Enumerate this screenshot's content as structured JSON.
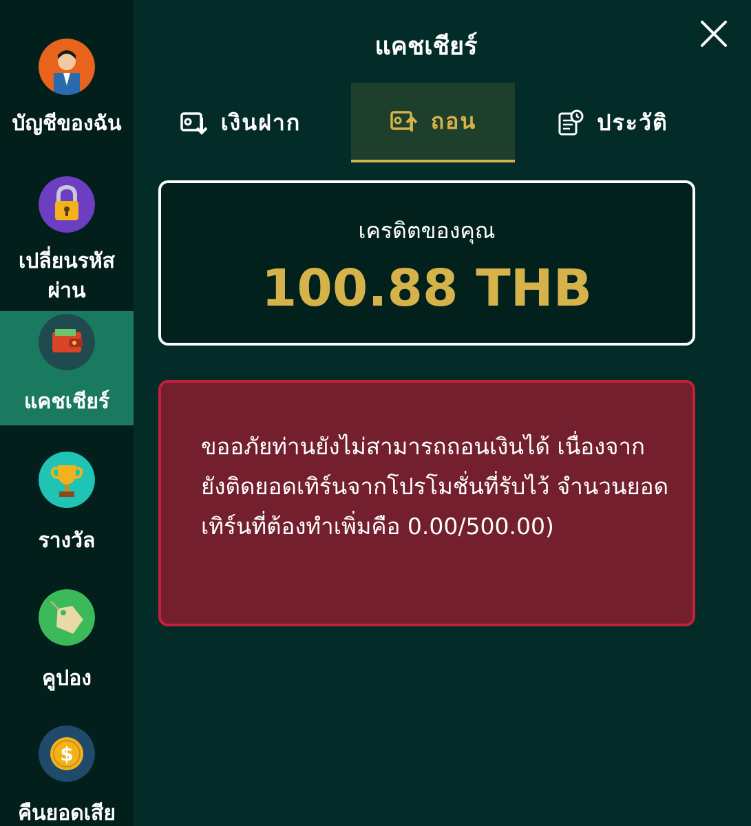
{
  "sidebar": {
    "items": [
      {
        "label": "บัญชีของฉัน",
        "icon": "user-avatar-icon"
      },
      {
        "label": "เปลี่ยนรหัสผ่าน",
        "icon": "padlock-icon"
      },
      {
        "label": "แคชเชียร์",
        "icon": "wallet-icon",
        "active": true
      },
      {
        "label": "รางวัล",
        "icon": "trophy-icon"
      },
      {
        "label": "คูปอง",
        "icon": "coupon-tag-icon"
      },
      {
        "label": "คืนยอดเสีย",
        "icon": "dollar-coin-icon"
      }
    ]
  },
  "header": {
    "title": "แคชเชียร์",
    "close_icon": "close-icon"
  },
  "tabs": [
    {
      "label": "เงินฝาก",
      "icon": "deposit-icon"
    },
    {
      "label": "ถอน",
      "icon": "withdraw-icon",
      "active": true
    },
    {
      "label": "ประวัติ",
      "icon": "history-icon"
    }
  ],
  "credit": {
    "label": "เครดิตของคุณ",
    "value": "100.88 THB"
  },
  "alert": {
    "message": "ขออภัยท่านยังไม่สามารถถอนเงินได้ เนื่องจากยังติดยอดเทิร์นจากโปรโมชั่นที่รับไว้ จำนวนยอดเทิร์นที่ต้องทำเพิ่มคือ 0.00/500.00)"
  },
  "colors": {
    "accent": "#d6b24a",
    "background": "#032b28",
    "sidebar": "#031f1b",
    "active": "#1a7a60",
    "alert": "#731f2e"
  }
}
